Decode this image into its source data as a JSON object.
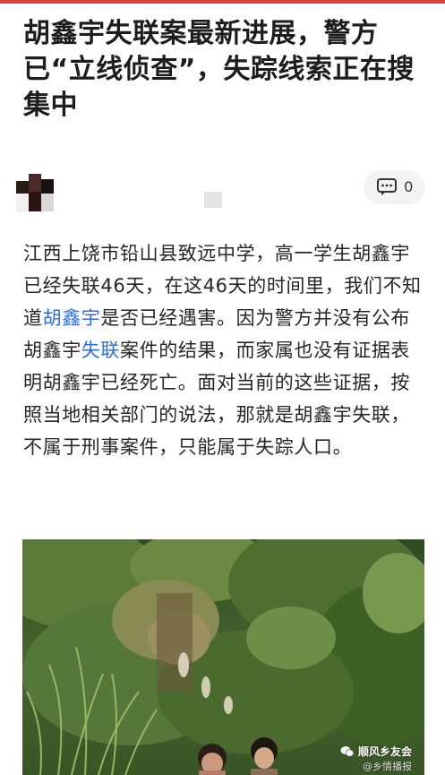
{
  "article": {
    "title": "胡鑫宇失联案最新进展，警方已“立线侦查”，失踪线索正在搜集中",
    "comment_count": "0",
    "body": [
      {
        "text": "江西上饶市铅山县致远中学，高一学生胡鑫宇已经失联46天，在这46天的时间里，我们不知道",
        "link": false
      },
      {
        "text": "胡鑫宇",
        "link": true
      },
      {
        "text": "是否已经遇害。因为警方并没有公布胡鑫宇",
        "link": false
      },
      {
        "text": "失联",
        "link": true
      },
      {
        "text": "案件的结果，而家属也没有证据表明胡鑫宇已经死亡。面对当前的这些证据，按照当地相关部门的说法，那就是胡鑫宇失联，不属于刑事案件，只能属于失踪人口。",
        "link": false
      }
    ]
  },
  "photo": {
    "watermark_primary": "顺风乡友会",
    "watermark_secondary": "@乡情播报"
  },
  "icons": {
    "comment": "comment-icon",
    "watermark_logo": "wechat-logo-icon"
  },
  "colors": {
    "accent_red": "#e23b3b",
    "link_blue": "#2e6fd6",
    "text": "#262626"
  }
}
